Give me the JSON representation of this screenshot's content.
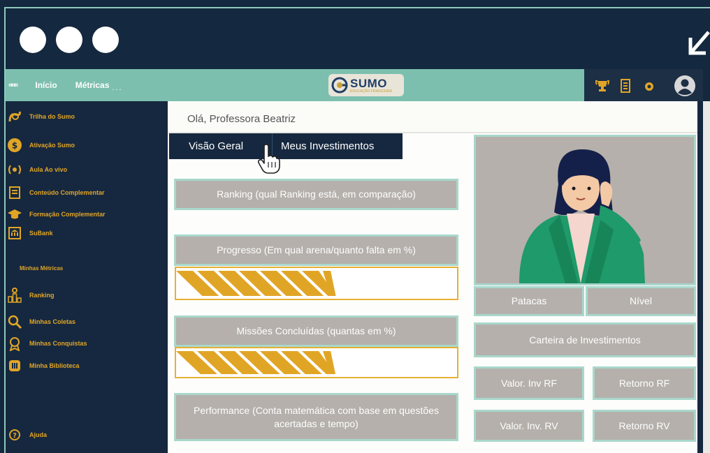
{
  "window": {
    "controls": [
      "close",
      "minimize",
      "maximize"
    ],
    "expand_icon": "expand-diagonal-icon"
  },
  "topbar": {
    "collapse_label": "«««",
    "nav": [
      {
        "label": "Início"
      },
      {
        "label": "Métricas"
      }
    ],
    "nav_dots": "...",
    "logo": {
      "text": "SUMO",
      "tagline": "EDUCAÇÃO FINANCEIRA"
    },
    "icons": [
      "trophy-icon",
      "ledger-icon",
      "settings-icon",
      "user-avatar-icon"
    ]
  },
  "sidebar": {
    "items": [
      {
        "label": "Trilha do Sumo",
        "icon": "path-icon"
      },
      {
        "label": "Ativação Sumo",
        "icon": "coin-icon"
      },
      {
        "label": "Aula Ao vivo",
        "icon": "broadcast-icon"
      },
      {
        "label": "Conteúdo Complementar",
        "icon": "document-icon"
      },
      {
        "label": "Formação Complementar",
        "icon": "graduation-cap-icon"
      },
      {
        "label": "SuBank",
        "icon": "bank-icon"
      }
    ],
    "section_title": "Minhas Métricas",
    "metrics_items": [
      {
        "label": "Ranking",
        "icon": "ranking-icon"
      },
      {
        "label": "Minhas Coletas",
        "icon": "search-icon"
      },
      {
        "label": "Minhas Conquistas",
        "icon": "medal-icon"
      },
      {
        "label": "Minha Biblioteca",
        "icon": "library-icon"
      }
    ],
    "help": {
      "label": "Ajuda",
      "icon": "help-icon"
    }
  },
  "main": {
    "greeting": "Olá, Professora Beatriz",
    "tabs": [
      {
        "label": "Visão Geral"
      },
      {
        "label": "Meus Investimentos"
      }
    ],
    "cards": {
      "ranking": "Ranking (qual Ranking está, em comparação)",
      "progress": "Progresso (Em qual arena/quanto falta em %)",
      "missions": "Missões Concluídas (quantas em %)",
      "performance": "Performance (Conta matemática com base em questões acertadas e tempo)"
    },
    "progress_fraction": 0.55,
    "missions_fraction": 0.55
  },
  "profile": {
    "patacas": "Patacas",
    "nivel": "Nível",
    "carteira": "Carteira de Investimentos",
    "valor_inv_rf": "Valor. Inv RF",
    "retorno_rf": "Retorno RF",
    "valor_inv_rv": "Valor. Inv. RV",
    "retorno_rv": "Retorno RV"
  },
  "colors": {
    "navy": "#16283f",
    "teal": "#7dbfae",
    "gold": "#e1a526",
    "card_gray": "#b5b0ab",
    "card_border": "#a9d7cc"
  }
}
